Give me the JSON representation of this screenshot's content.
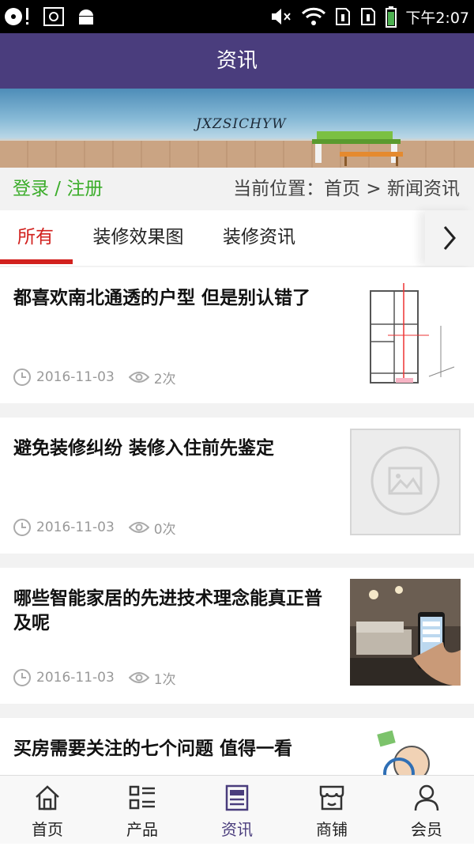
{
  "status_bar": {
    "time": "下午2:07"
  },
  "header": {
    "title": "资讯"
  },
  "banner": {
    "brand_text": "JXZSICHYW"
  },
  "location_bar": {
    "login_link": "登录 / 注册",
    "breadcrumb": "当前位置：首页 > 新闻资讯"
  },
  "tabs": [
    {
      "label": "所有",
      "active": true
    },
    {
      "label": "装修效果图"
    },
    {
      "label": "装修资讯"
    }
  ],
  "articles": [
    {
      "title": "都喜欢南北通透的户型 但是别认错了",
      "date": "2016-11-03",
      "views": "2次",
      "thumbnail": "floor-plan"
    },
    {
      "title": "避免装修纠纷 装修入住前先鉴定",
      "date": "2016-11-03",
      "views": "0次",
      "thumbnail": "placeholder-image-icon"
    },
    {
      "title": "哪些智能家居的先进技术理念能真正普及呢",
      "date": "2016-11-03",
      "views": "1次",
      "thumbnail": "smart-home-photo"
    },
    {
      "title": "买房需要关注的七个问题 值得一看",
      "date": "",
      "views": "",
      "thumbnail": "cartoon-magnifier"
    }
  ],
  "bottom_nav": [
    {
      "label": "首页",
      "icon": "home-icon"
    },
    {
      "label": "产品",
      "icon": "product-list-icon"
    },
    {
      "label": "资讯",
      "icon": "news-icon",
      "active": true
    },
    {
      "label": "商铺",
      "icon": "shop-icon"
    },
    {
      "label": "会员",
      "icon": "member-icon"
    }
  ],
  "colors": {
    "primary": "#4a3d7d",
    "tab_active": "#d2211e",
    "login": "#3cad2b"
  }
}
